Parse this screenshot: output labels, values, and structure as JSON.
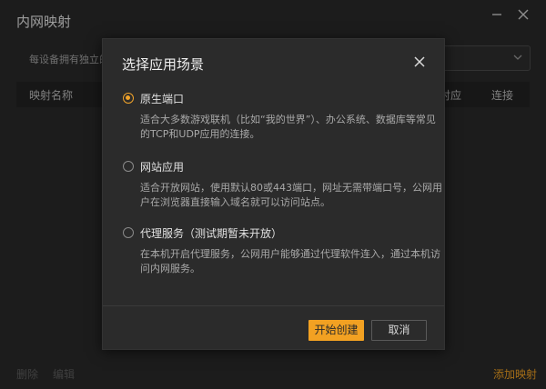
{
  "window": {
    "title": "内网映射",
    "minimize_icon": "minimize-icon",
    "close_icon": "close-icon"
  },
  "background": {
    "description": "每设备拥有独立的",
    "table_headers": [
      "映射名称",
      "对应",
      "连接"
    ],
    "bottom": {
      "delete_label": "删除",
      "edit_label": "编辑",
      "add_label": "添加映射"
    }
  },
  "dialog": {
    "title": "选择应用场景",
    "options": [
      {
        "label": "原生端口",
        "selected": true,
        "desc": "适合大多数游戏联机（比如“我的世界”）、办公系统、数据库等常见的TCP和UDP应用的连接。"
      },
      {
        "label": "网站应用",
        "selected": false,
        "desc": "适合开放网站，使用默认80或443端口，网址无需带端口号，公网用户在浏览器直接输入域名就可以访问站点。"
      },
      {
        "label": "代理服务（测试期暂未开放）",
        "selected": false,
        "desc": "在本机开启代理服务，公网用户能够通过代理软件连入，通过本机访问内网服务。"
      }
    ],
    "confirm_label": "开始创建",
    "cancel_label": "取消"
  },
  "colors": {
    "accent": "#f2a122",
    "background": "#2a2a2a",
    "dialog_bg": "#2b2b2b"
  }
}
